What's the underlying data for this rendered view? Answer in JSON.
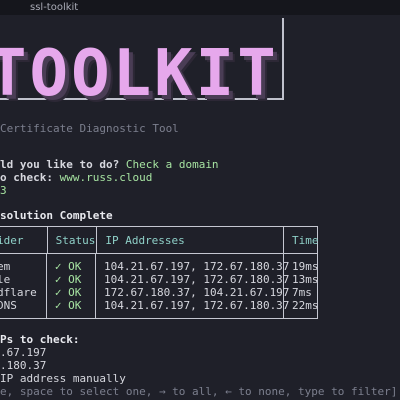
{
  "window": {
    "title": "ssl-toolkit"
  },
  "banner": {
    "text": "TOOLKIT"
  },
  "subtitle": "Certificate Diagnostic Tool",
  "prompt1": {
    "question": "ld you like to do?",
    "answer": "Check a domain"
  },
  "prompt2": {
    "question": "o check:",
    "answer": "www.russ.cloud"
  },
  "prompt3": {
    "answer": "3"
  },
  "section_title": "solution Complete",
  "table": {
    "headers": [
      "ider",
      "Status",
      "IP Addresses",
      "Time"
    ],
    "rows": [
      {
        "provider": "em",
        "status": "✓ OK",
        "ips": "104.21.67.197, 172.67.180.37",
        "time": "19ms"
      },
      {
        "provider": "le",
        "status": "✓ OK",
        "ips": "104.21.67.197, 172.67.180.37",
        "time": "13ms"
      },
      {
        "provider": "dflare",
        "status": "✓ OK",
        "ips": "172.67.180.37, 104.21.67.197",
        "time": "7ms"
      },
      {
        "provider": "DNS",
        "status": "✓ OK",
        "ips": "104.21.67.197, 172.67.180.37",
        "time": "22ms"
      }
    ]
  },
  "ip_prompt": {
    "title": "Ps to check:",
    "options": [
      ".67.197",
      ".180.37",
      "IP address manually"
    ],
    "hint": "e, space to select one, → to all, ← to none, type to filter]"
  },
  "colors": {
    "accent_green": "#a6e3a1",
    "banner_pink": "#e6a8ec",
    "header_teal": "#8fd0c8"
  }
}
